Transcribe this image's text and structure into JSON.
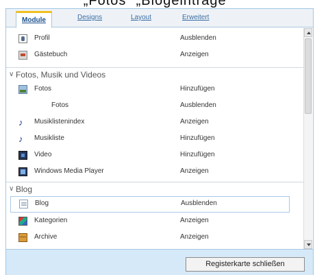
{
  "header_text": "„Fotos“ „Blogeinträge“",
  "tabs": [
    {
      "label": "Module"
    },
    {
      "label": "Designs"
    },
    {
      "label": "Layout"
    },
    {
      "label": "Erweitert"
    }
  ],
  "rows": [
    {
      "label": "Profil",
      "action": "Ausblenden",
      "icon": "profile-icon"
    },
    {
      "label": "Gästebuch",
      "action": "Anzeigen",
      "icon": "guestbook-icon"
    },
    {
      "label": "Fotos",
      "action": "Hinzufügen",
      "icon": "photo-icon"
    },
    {
      "label": "Fotos",
      "action": "Ausblenden",
      "icon": ""
    },
    {
      "label": "Musiklistenindex",
      "action": "Anzeigen",
      "icon": "music-note-icon"
    },
    {
      "label": "Musikliste",
      "action": "Hinzufügen",
      "icon": "music-note-icon"
    },
    {
      "label": "Video",
      "action": "Hinzufügen",
      "icon": "video-icon"
    },
    {
      "label": "Windows Media Player",
      "action": "Anzeigen",
      "icon": "media-player-icon"
    },
    {
      "label": "Blog",
      "action": "Ausblenden",
      "icon": "blog-icon"
    },
    {
      "label": "Kategorien",
      "action": "Anzeigen",
      "icon": "categories-icon"
    },
    {
      "label": "Archive",
      "action": "Anzeigen",
      "icon": "archive-icon"
    }
  ],
  "groups": [
    {
      "title": "Fotos, Musik und Videos"
    },
    {
      "title": "Blog"
    }
  ],
  "footer": {
    "close_label": "Registerkarte schließen"
  },
  "colors": {
    "accent": "#f0c020",
    "tab_link": "#3a6ea5",
    "footer_bg": "#d6e9f8",
    "border": "#9fc6e4"
  }
}
